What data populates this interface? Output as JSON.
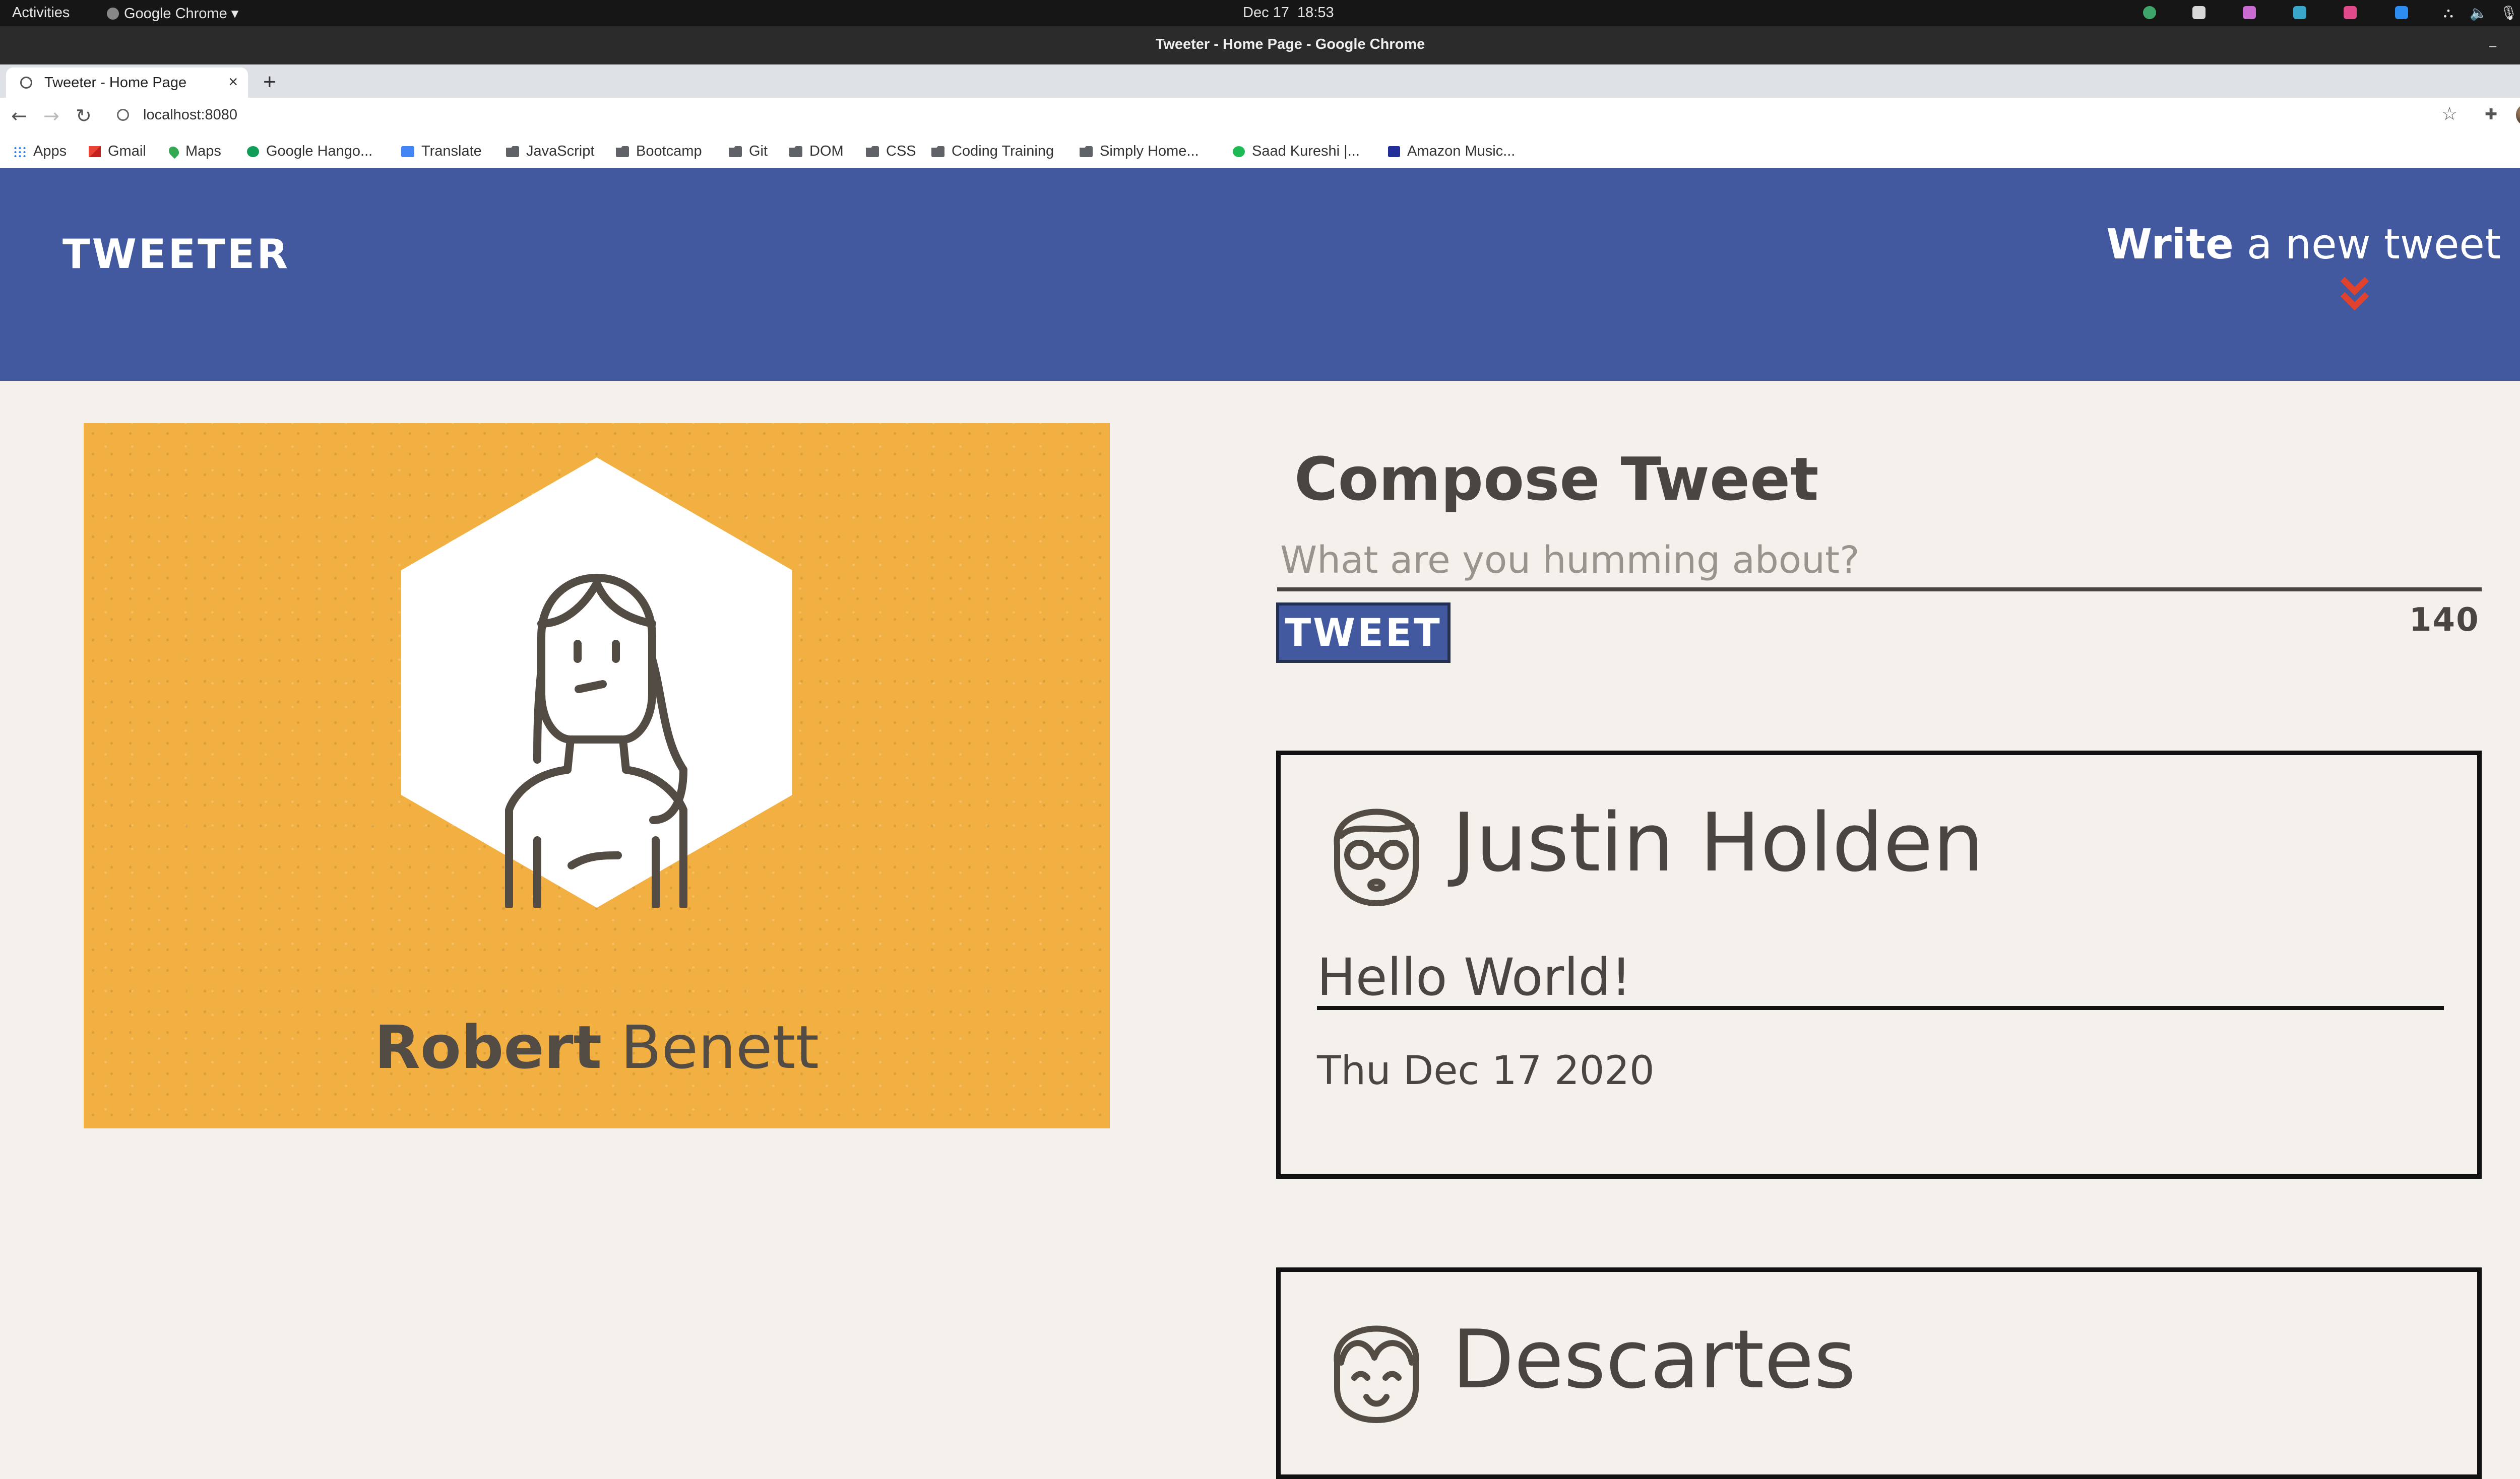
{
  "system_bar": {
    "activities": "Activities",
    "app_menu": "Google Chrome",
    "date": "Dec 17",
    "time": "18:53"
  },
  "window": {
    "title": "Tweeter - Home Page - Google Chrome"
  },
  "tabs": [
    {
      "label": "Tweeter - Home Page"
    }
  ],
  "address_bar": {
    "url": "localhost:8080"
  },
  "bookmarks": [
    {
      "label": "Apps",
      "icon": "apps-grid-icon"
    },
    {
      "label": "Gmail",
      "icon": "gmail-icon"
    },
    {
      "label": "Maps",
      "icon": "maps-icon"
    },
    {
      "label": "Google Hango...",
      "icon": "hangouts-icon"
    },
    {
      "label": "Translate",
      "icon": "translate-icon"
    },
    {
      "label": "JavaScript",
      "icon": "folder-icon"
    },
    {
      "label": "Bootcamp",
      "icon": "folder-icon"
    },
    {
      "label": "Git",
      "icon": "folder-icon"
    },
    {
      "label": "DOM",
      "icon": "folder-icon"
    },
    {
      "label": "CSS",
      "icon": "folder-icon"
    },
    {
      "label": "Coding Training",
      "icon": "folder-icon"
    },
    {
      "label": "Simply Home...",
      "icon": "folder-icon"
    },
    {
      "label": "Saad Kureshi |...",
      "icon": "spotify-icon"
    },
    {
      "label": "Amazon Music...",
      "icon": "amazon-music-icon"
    }
  ],
  "page": {
    "logo": "TWEETER",
    "nav": {
      "bold": "Write",
      "rest": "a new tweet"
    },
    "profile": {
      "first": "Robert",
      "last": "Benett"
    },
    "compose": {
      "title": "Compose Tweet",
      "placeholder": "What are you humming about?",
      "button": "TWEET",
      "counter": "140"
    },
    "tweets": [
      {
        "name": "Justin Holden",
        "text": "Hello World!",
        "date": "Thu Dec 17 2020"
      },
      {
        "name": "Descartes",
        "text": "",
        "date": ""
      }
    ]
  },
  "colors": {
    "header": "#4259a0",
    "accent_chevron": "#e0422d",
    "profile_bg": "#f2b042",
    "page_bg": "#f4f1ec",
    "text": "#4a4540"
  }
}
